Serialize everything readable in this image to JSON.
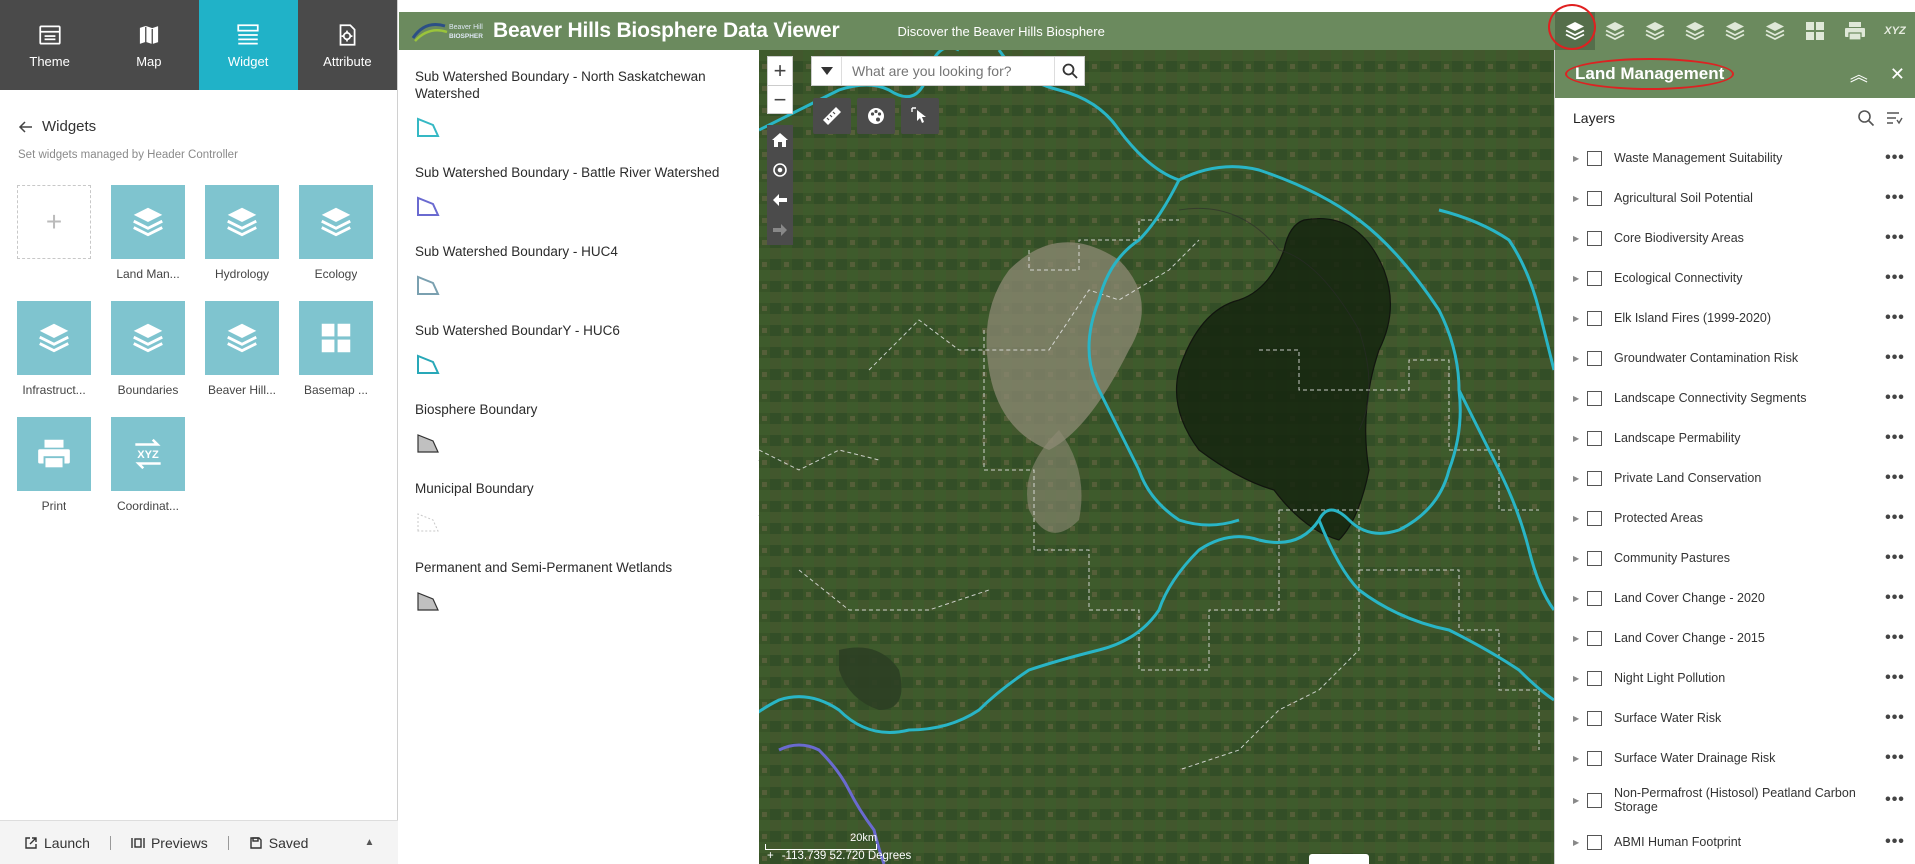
{
  "builder": {
    "tabs": [
      {
        "label": "Theme",
        "icon": "theme-icon"
      },
      {
        "label": "Map",
        "icon": "map-icon"
      },
      {
        "label": "Widget",
        "icon": "widget-icon"
      },
      {
        "label": "Attribute",
        "icon": "attribute-icon"
      }
    ],
    "active_tab": "Widget",
    "heading": "Widgets",
    "subtitle": "Set widgets managed by Header Controller",
    "widgets": [
      {
        "label": "",
        "icon": "plus-icon"
      },
      {
        "label": "Land Man...",
        "icon": "layers-icon"
      },
      {
        "label": "Hydrology",
        "icon": "layers-icon"
      },
      {
        "label": "Ecology",
        "icon": "layers-icon"
      },
      {
        "label": "Infrastruct...",
        "icon": "layers-icon"
      },
      {
        "label": "Boundaries",
        "icon": "layers-icon"
      },
      {
        "label": "Beaver Hill...",
        "icon": "layers-icon"
      },
      {
        "label": "Basemap ...",
        "icon": "basemap-icon"
      },
      {
        "label": "Print",
        "icon": "print-icon"
      },
      {
        "label": "Coordinat...",
        "icon": "xyz-icon"
      }
    ],
    "footer": {
      "launch": "Launch",
      "previews": "Previews",
      "saved": "Saved"
    }
  },
  "app": {
    "title": "Beaver Hills Biosphere Data Viewer",
    "subtitle": "Discover the Beaver Hills Biosphere",
    "logo_text": "Beaver Hills BIOSPHERE",
    "header_icons": [
      "layers-icon",
      "layers-icon",
      "layers-icon",
      "layers-icon",
      "layers-icon",
      "layers-icon",
      "basemap-icon",
      "print-icon",
      "xyz-icon"
    ],
    "xyz_label": "XYZ"
  },
  "legend": {
    "items": [
      {
        "title": "Sub Watershed Boundary - North Saskatchewan Watershed",
        "color": "#35b8c4",
        "style": "solid"
      },
      {
        "title": "Sub Watershed Boundary - Battle River Watershed",
        "color": "#6a6ad0",
        "style": "solid"
      },
      {
        "title": "Sub Watershed Boundary - HUC4",
        "color": "#7aa0b0",
        "style": "solid"
      },
      {
        "title": "Sub Watershed BoundarY - HUC6",
        "color": "#28a8b8",
        "style": "solid"
      },
      {
        "title": "Biosphere Boundary",
        "color": "#333333",
        "style": "fill"
      },
      {
        "title": "Municipal Boundary",
        "color": "#c8c8c8",
        "style": "dashed"
      },
      {
        "title": "Permanent and Semi-Permanent Wetlands",
        "color": "#333333",
        "style": "fill"
      }
    ]
  },
  "map": {
    "search_placeholder": "What are you looking for?",
    "scale_label": "20km",
    "coordinates": "-113.739 52.720 Degrees"
  },
  "layers_panel": {
    "title": "Land Management",
    "section": "Layers",
    "layers": [
      "Waste Management Suitability",
      "Agricultural Soil Potential",
      "Core Biodiversity Areas",
      "Ecological Connectivity",
      "Elk Island Fires (1999-2020)",
      "Groundwater Contamination Risk",
      "Landscape Connectivity Segments",
      "Landscape Permability",
      "Private Land Conservation",
      "Protected Areas",
      "Community Pastures",
      "Land Cover Change - 2020",
      "Land Cover Change - 2015",
      "Night Light Pollution",
      "Surface Water Risk",
      "Surface Water Drainage Risk",
      "Non-Permafrost (Histosol) Peatland Carbon Storage",
      "ABMI Human Footprint"
    ],
    "more_label": "•••"
  },
  "colors": {
    "header": "#6b8a5e",
    "accent": "#20b2c8",
    "tile": "#7fc4cf",
    "river": "#29b5c6",
    "annotation": "#e02020"
  }
}
